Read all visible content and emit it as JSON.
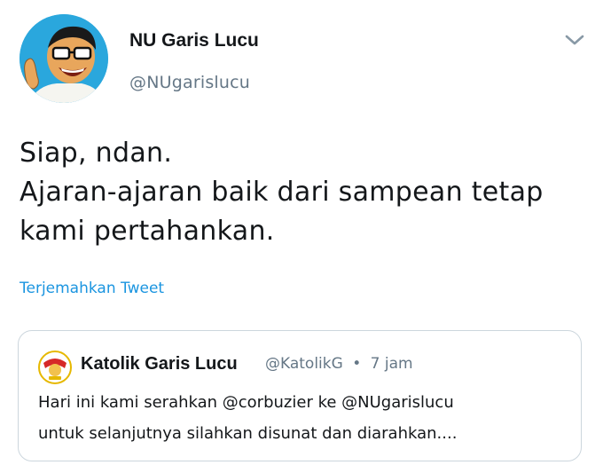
{
  "tweet": {
    "author": {
      "display_name": "NU Garis Lucu",
      "handle": "@NUgarislucu",
      "avatar_icon": "caricature-avatar-icon"
    },
    "text_lines": [
      "Siap, ndan.",
      "Ajaran-ajaran baik dari sampean tetap",
      "kami pertahankan."
    ],
    "translate_label": "Terjemahkan Tweet",
    "menu_icon": "chevron-down-icon"
  },
  "quoted_tweet": {
    "display_name": "Katolik Garis Lucu",
    "handle": "@KatolikG",
    "separator": "•",
    "time": "7 jam",
    "avatar_icon": "katolik-logo-icon",
    "text_lines": [
      "Hari ini kami serahkan @corbuzier ke @NUgarislucu",
      "untuk selanjutnya silahkan disunat dan diarahkan...."
    ]
  },
  "colors": {
    "text": "#14171a",
    "secondary": "#657786",
    "link": "#1b95e0",
    "border": "#ccd6dd",
    "avatar_bg": "#2aa7dd",
    "quote_logo": "#d62828"
  }
}
